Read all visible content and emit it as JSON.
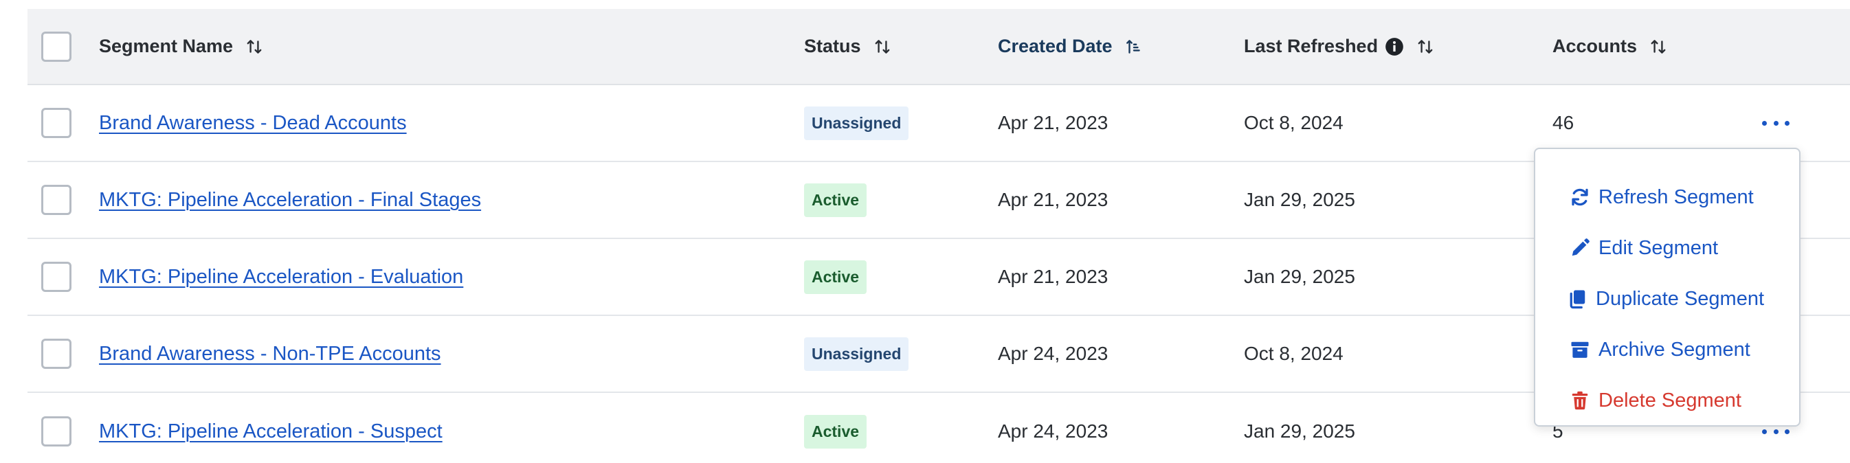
{
  "colors": {
    "link": "#1a56c4",
    "danger": "#d6392f",
    "header_bg": "#f1f2f4",
    "badge_active_bg": "#d8f6e0",
    "badge_unassigned_bg": "#e8f1fb"
  },
  "table": {
    "columns": {
      "name": "Segment Name",
      "status": "Status",
      "created": "Created Date",
      "refreshed": "Last Refreshed",
      "accounts": "Accounts"
    },
    "rows": [
      {
        "name": "Brand Awareness - Dead Accounts",
        "status": "Unassigned",
        "created": "Apr 21, 2023",
        "refreshed": "Oct 8, 2024",
        "accounts": "46"
      },
      {
        "name": "MKTG: Pipeline Acceleration - Final Stages",
        "status": "Active",
        "created": "Apr 21, 2023",
        "refreshed": "Jan 29, 2025",
        "accounts": ""
      },
      {
        "name": "MKTG: Pipeline Acceleration - Evaluation",
        "status": "Active",
        "created": "Apr 21, 2023",
        "refreshed": "Jan 29, 2025",
        "accounts": ""
      },
      {
        "name": "Brand Awareness - Non-TPE Accounts",
        "status": "Unassigned",
        "created": "Apr 24, 2023",
        "refreshed": "Oct 8, 2024",
        "accounts": ""
      },
      {
        "name": "MKTG: Pipeline Acceleration - Suspect",
        "status": "Active",
        "created": "Apr 24, 2023",
        "refreshed": "Jan 29, 2025",
        "accounts": "5"
      }
    ]
  },
  "menu": {
    "refresh": "Refresh Segment",
    "edit": "Edit Segment",
    "duplicate": "Duplicate Segment",
    "archive": "Archive Segment",
    "delete": "Delete Segment"
  },
  "icons": {
    "sort": "sort-icon",
    "sort_asc": "sort-ascending-icon",
    "info": "info-icon",
    "more": "more-horizontal-icon",
    "refresh": "refresh-icon",
    "edit": "pencil-icon",
    "duplicate": "copy-icon",
    "archive": "archive-box-icon",
    "delete": "trash-icon"
  }
}
